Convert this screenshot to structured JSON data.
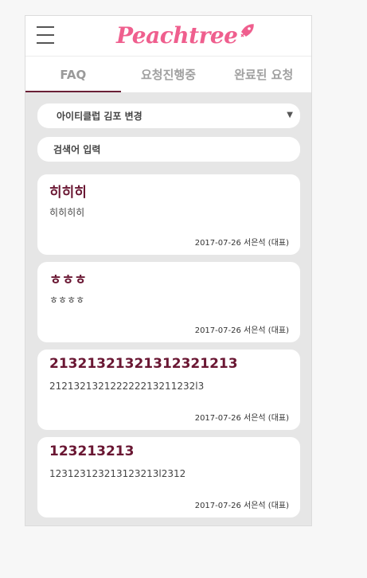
{
  "header": {
    "logo_text": "Peachtree",
    "colors": {
      "brand": "#ef5f8e",
      "accent": "#6a1733",
      "background": "#e6e6e6"
    }
  },
  "tabs": [
    {
      "label": "FAQ",
      "active": true
    },
    {
      "label": "요청진행중",
      "active": false
    },
    {
      "label": "완료된 요청",
      "active": false
    }
  ],
  "filter": {
    "selected": "아이티클럽 김포 변경",
    "search_placeholder": "검색어 입력"
  },
  "posts": [
    {
      "title": "히히히",
      "body": "히히히히",
      "date": "2017-07-26",
      "author": "서은석 (대표)"
    },
    {
      "title": "ㅎㅎㅎ",
      "body": "ㅎㅎㅎㅎ",
      "date": "2017-07-26",
      "author": "서은석 (대표)"
    },
    {
      "title": "21321321321312321213",
      "body": "212132132122222213211232l3",
      "date": "2017-07-26",
      "author": "서은석 (대표)"
    },
    {
      "title": "123213213",
      "body": "123123123213123213l2312",
      "date": "2017-07-26",
      "author": "서은석 (대표)"
    }
  ]
}
